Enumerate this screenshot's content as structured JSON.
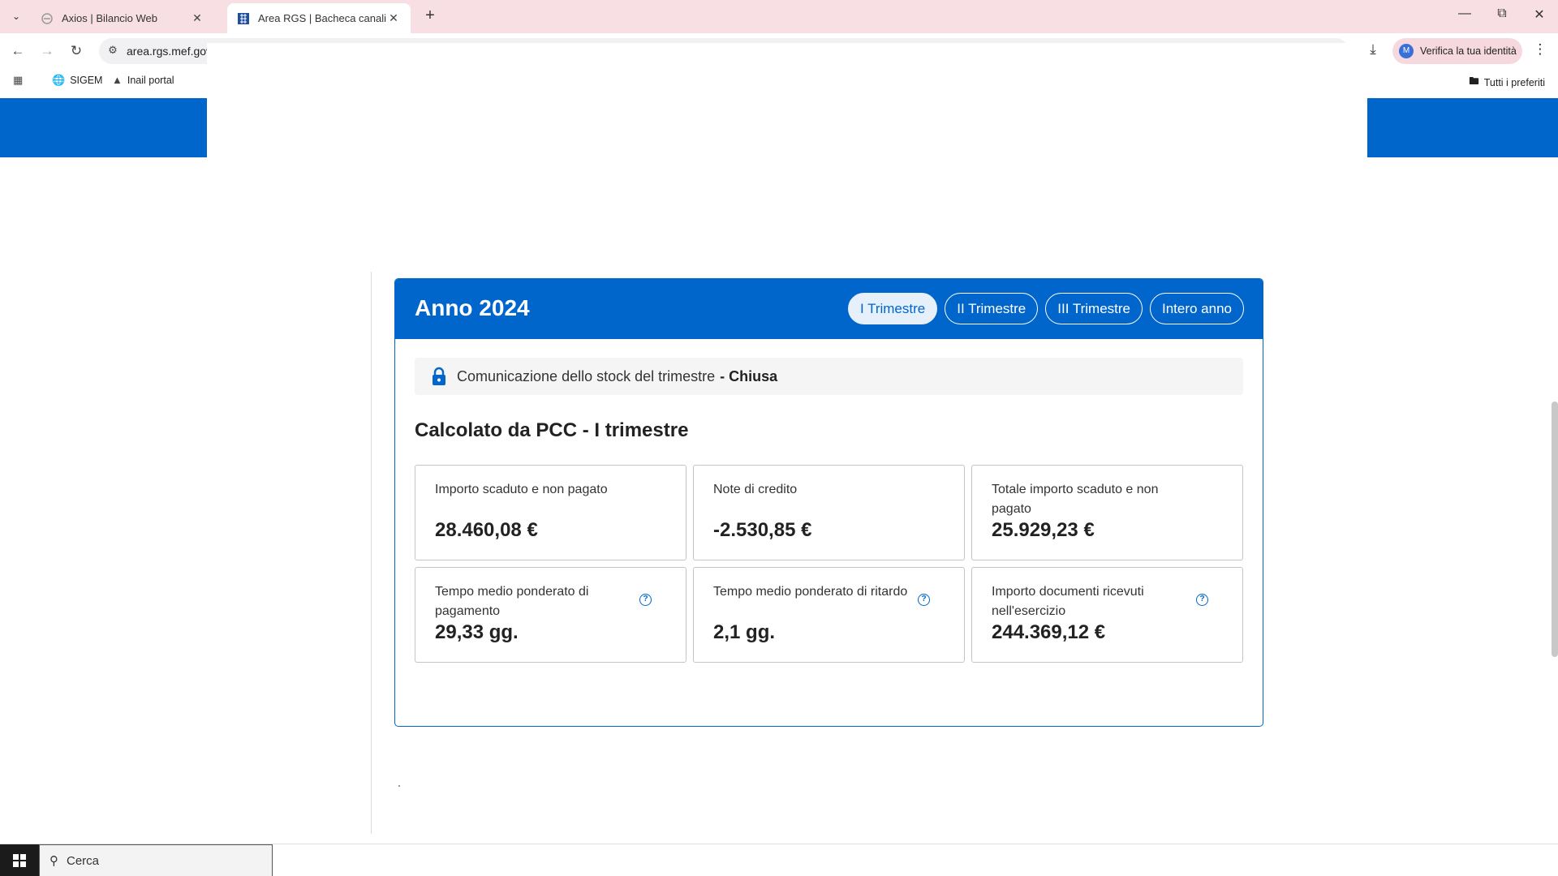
{
  "browser": {
    "tabs": [
      {
        "title": "Axios | Bilancio Web",
        "active": false
      },
      {
        "title": "Area RGS | Bacheca canali",
        "active": true
      }
    ],
    "url": "area.rgs.mef.gov",
    "profile_label": "Verifica la tua identità",
    "bookmarks": [
      "SIGEM",
      "Inail portal"
    ],
    "all_bookmarks_label": "Tutti i preferiti"
  },
  "card": {
    "title": "Anno 2024",
    "periods": [
      "I Trimestre",
      "II Trimestre",
      "III Trimestre",
      "Intero anno"
    ],
    "selected_period": "I Trimestre",
    "status": {
      "text": "Comunicazione dello stock del trimestre",
      "separator": "-",
      "value": "Chiusa"
    },
    "section_title": "Calcolato da PCC - I trimestre",
    "metrics": [
      {
        "label": "Importo scaduto e non pagato",
        "value": "28.460,08 €",
        "help": false
      },
      {
        "label": "Note di credito",
        "value": "-2.530,85 €",
        "help": false
      },
      {
        "label": "Totale importo scaduto e non pagato",
        "value": "25.929,23 €",
        "help": false
      },
      {
        "label": "Tempo medio ponderato di pagamento",
        "value": "29,33 gg.",
        "help": true
      },
      {
        "label": "Tempo medio ponderato di ritardo",
        "value": "2,1 gg.",
        "help": true
      },
      {
        "label": "Importo documenti ricevuti nell'esercizio",
        "value": "244.369,12 €",
        "help": true
      }
    ],
    "accent_color": "#0066cc"
  },
  "taskbar": {
    "search_placeholder": "Cerca"
  }
}
